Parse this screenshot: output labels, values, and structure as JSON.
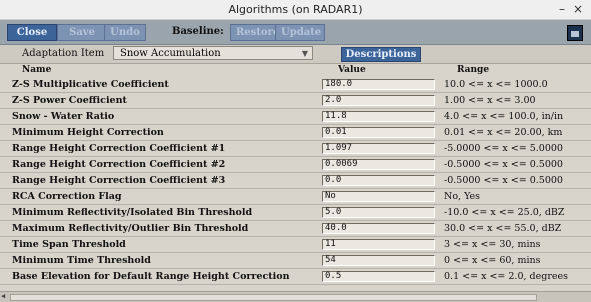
{
  "window": {
    "title": "Algorithms (on RADAR1)",
    "minimize": "–",
    "close": "×"
  },
  "toolbar": {
    "close_label": "Close",
    "save_label": "Save",
    "undo_label": "Undo",
    "baseline_label": "Baseline:",
    "restore_label": "Restore",
    "update_label": "Update"
  },
  "adaptation": {
    "label": "Adaptation Item",
    "selected": "Snow Accumulation",
    "descriptions_label": "Descriptions"
  },
  "table": {
    "headers": {
      "name": "Name",
      "value": "Value",
      "range": "Range"
    },
    "rows": [
      {
        "name": "Z-S Multiplicative Coefficient",
        "value": "180.0",
        "range": "10.0 <= x <= 1000.0"
      },
      {
        "name": "Z-S Power Coefficient",
        "value": "2.0",
        "range": "1.00 <= x <= 3.00"
      },
      {
        "name": "Snow - Water Ratio",
        "value": "11.8",
        "range": "4.0 <= x <= 100.0, in/in"
      },
      {
        "name": "Minimum Height Correction",
        "value": "0.01",
        "range": "0.01 <= x <= 20.00, km"
      },
      {
        "name": "Range Height Correction Coefficient #1",
        "value": "1.097",
        "range": "-5.0000 <= x <= 5.0000"
      },
      {
        "name": "Range Height Correction Coefficient #2",
        "value": "0.0069",
        "range": "-0.5000 <= x <= 0.5000"
      },
      {
        "name": "Range Height Correction Coefficient #3",
        "value": "0.0",
        "range": "-0.5000 <= x <= 0.5000"
      },
      {
        "name": "RCA Correction Flag",
        "value": "No",
        "range": "No, Yes"
      },
      {
        "name": "Minimum Reflectivity/Isolated Bin Threshold",
        "value": "5.0",
        "range": "-10.0 <= x <= 25.0, dBZ"
      },
      {
        "name": "Maximum Reflectivity/Outlier Bin Threshold",
        "value": "40.0",
        "range": "30.0 <= x <= 55.0, dBZ"
      },
      {
        "name": "Time Span Threshold",
        "value": "11",
        "range": "3 <= x <= 30, mins"
      },
      {
        "name": "Minimum Time Threshold",
        "value": "54",
        "range": "0 <= x <= 60, mins"
      },
      {
        "name": "Base Elevation for Default Range Height Correction",
        "value": "0.5",
        "range": "0.1 <= x <= 2.0, degrees"
      }
    ]
  }
}
